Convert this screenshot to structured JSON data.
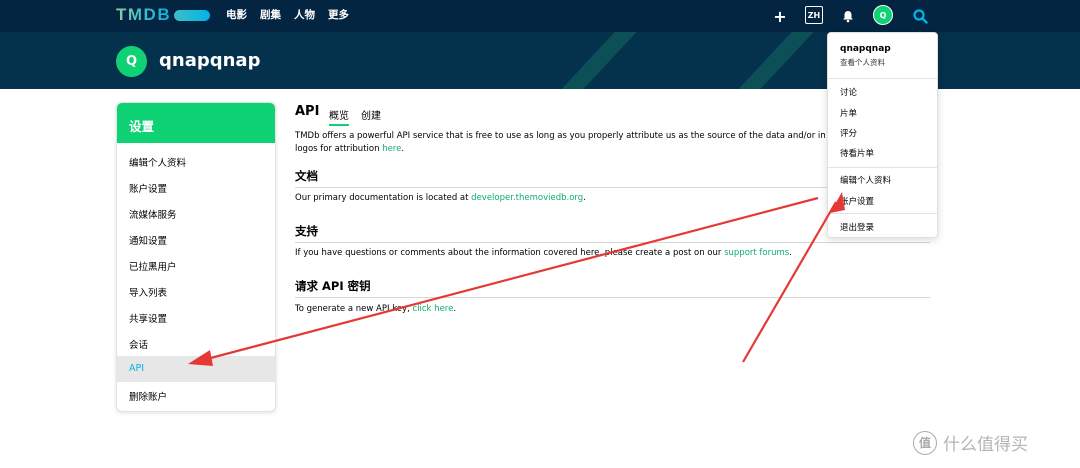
{
  "topnav": {
    "logo": "TMDB",
    "links": [
      "电影",
      "剧集",
      "人物",
      "更多"
    ],
    "lang": "ZH",
    "avatar_initial": "Q"
  },
  "banner": {
    "avatar_initial": "Q",
    "username": "qnapqnap"
  },
  "sidebar": {
    "title": "设置",
    "items": [
      "编辑个人资料",
      "账户设置",
      "流媒体服务",
      "通知设置",
      "已拉黑用户",
      "导入列表",
      "共享设置",
      "会话",
      "API",
      "删除账户"
    ],
    "active_index": 8
  },
  "main": {
    "title": "API",
    "tabs": [
      "概览",
      "创建"
    ],
    "intro_line1": "TMDb offers a powerful API service that is free to use as long as you properly attribute us as the source of the data and/or images yo",
    "intro_line2_prefix": "logos for attribution ",
    "intro_link": "here",
    "intro_end": ".",
    "docs_title": "文档",
    "docs_prefix": "Our primary documentation is located at ",
    "docs_link": "developer.themoviedb.org",
    "docs_end": ".",
    "support_title": "支持",
    "support_prefix": "If you have questions or comments about the information covered here, please create a post on our ",
    "support_link": "support forums",
    "support_end": ".",
    "key_title": "请求 API 密钥",
    "key_prefix": "To generate a new API key, ",
    "key_link": "click here",
    "key_end": "."
  },
  "dropdown": {
    "name": "qnapqnap",
    "sub": "查看个人资料",
    "group1": [
      "讨论",
      "片单",
      "评分",
      "待看片单"
    ],
    "group2": [
      "编辑个人资料",
      "账户设置"
    ],
    "logout": "退出登录"
  },
  "watermark": {
    "text": "什么值得买",
    "glyph": "值"
  },
  "colors": {
    "nav": "#032541",
    "accent": "#0fd274",
    "link": "#01b4e4",
    "arrow": "#e53935"
  }
}
